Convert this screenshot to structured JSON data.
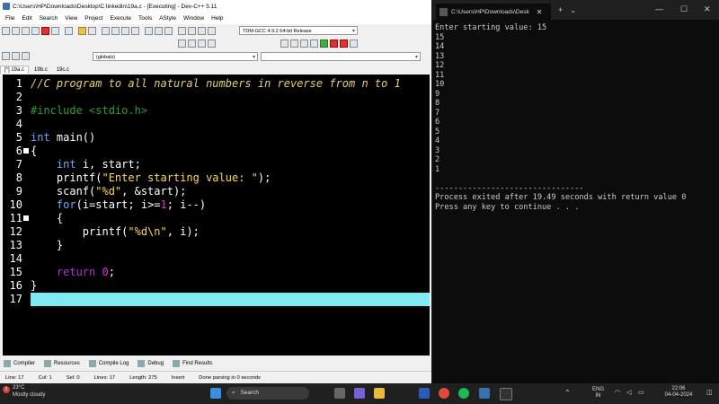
{
  "ide": {
    "title": "C:\\Users\\HP\\Downloads\\Desktop\\C linkedin\\19a.c - [Executing] - Dev-C++ 5.11",
    "menu": [
      "File",
      "Edit",
      "Search",
      "View",
      "Project",
      "Execute",
      "Tools",
      "AStyle",
      "Window",
      "Help"
    ],
    "compiler_select": "TDM-GCC 4.9.2 64-bit Release",
    "scope_select": "(globals)",
    "tabs": [
      "[*] 19a.c",
      "19b.c",
      "19c.c"
    ],
    "code_lines": [
      {
        "n": "1",
        "fold": false,
        "hl": false,
        "tokens": [
          {
            "t": "//C program to all natural numbers in reverse from n to 1",
            "c": "comment"
          }
        ]
      },
      {
        "n": "2",
        "fold": false,
        "hl": false,
        "tokens": []
      },
      {
        "n": "3",
        "fold": false,
        "hl": false,
        "tokens": [
          {
            "t": "#include <stdio.h>",
            "c": "pre"
          }
        ]
      },
      {
        "n": "4",
        "fold": false,
        "hl": false,
        "tokens": []
      },
      {
        "n": "5",
        "fold": false,
        "hl": false,
        "tokens": [
          {
            "t": "int",
            "c": "kw"
          },
          {
            "t": " main()",
            "c": "plain"
          }
        ]
      },
      {
        "n": "6",
        "fold": true,
        "hl": false,
        "tokens": [
          {
            "t": "{",
            "c": "plain"
          }
        ]
      },
      {
        "n": "7",
        "fold": false,
        "hl": false,
        "tokens": [
          {
            "t": "    ",
            "c": "plain"
          },
          {
            "t": "int",
            "c": "kw"
          },
          {
            "t": " i, start;",
            "c": "plain"
          }
        ]
      },
      {
        "n": "8",
        "fold": false,
        "hl": false,
        "tokens": [
          {
            "t": "    printf(",
            "c": "plain"
          },
          {
            "t": "\"Enter starting value: \"",
            "c": "str"
          },
          {
            "t": ");",
            "c": "plain"
          }
        ]
      },
      {
        "n": "9",
        "fold": false,
        "hl": false,
        "tokens": [
          {
            "t": "    scanf(",
            "c": "plain"
          },
          {
            "t": "\"%d\"",
            "c": "str"
          },
          {
            "t": ", &start);",
            "c": "plain"
          }
        ]
      },
      {
        "n": "10",
        "fold": false,
        "hl": false,
        "tokens": [
          {
            "t": "    ",
            "c": "plain"
          },
          {
            "t": "for",
            "c": "kw"
          },
          {
            "t": "(i=start; i>=",
            "c": "plain"
          },
          {
            "t": "1",
            "c": "num"
          },
          {
            "t": "; i--)",
            "c": "plain"
          }
        ]
      },
      {
        "n": "11",
        "fold": true,
        "hl": false,
        "tokens": [
          {
            "t": "    {",
            "c": "plain"
          }
        ]
      },
      {
        "n": "12",
        "fold": false,
        "hl": false,
        "tokens": [
          {
            "t": "        printf(",
            "c": "plain"
          },
          {
            "t": "\"%d\\n\"",
            "c": "str"
          },
          {
            "t": ", i);",
            "c": "plain"
          }
        ]
      },
      {
        "n": "13",
        "fold": false,
        "hl": false,
        "tokens": [
          {
            "t": "    }",
            "c": "plain"
          }
        ]
      },
      {
        "n": "14",
        "fold": false,
        "hl": false,
        "tokens": []
      },
      {
        "n": "15",
        "fold": false,
        "hl": false,
        "tokens": [
          {
            "t": "    ",
            "c": "plain"
          },
          {
            "t": "return",
            "c": "kw2"
          },
          {
            "t": " ",
            "c": "plain"
          },
          {
            "t": "0",
            "c": "num"
          },
          {
            "t": ";",
            "c": "plain"
          }
        ]
      },
      {
        "n": "16",
        "fold": false,
        "hl": false,
        "tokens": [
          {
            "t": "}",
            "c": "plain"
          }
        ]
      },
      {
        "n": "17",
        "fold": false,
        "hl": true,
        "tokens": []
      }
    ],
    "bottom_tabs": [
      "Compiler",
      "Resources",
      "Compile Log",
      "Debug",
      "Find Results"
    ],
    "status": {
      "line": "Line:   17",
      "col": "Col:   1",
      "sel": "Sel:   0",
      "lines": "Lines:   17",
      "length": "Length:   275",
      "mode": "Insert",
      "message": "Done parsing in 0 seconds"
    }
  },
  "terminal": {
    "tab_title": "C:\\Users\\HP\\Downloads\\Desk",
    "output": "Enter starting value: 15\n15\n14\n13\n12\n11\n10\n9\n8\n7\n6\n5\n4\n3\n2\n1\n\n--------------------------------\nProcess exited after 19.49 seconds with return value 0\nPress any key to continue . . ."
  },
  "taskbar": {
    "temp": "23°C",
    "weather": "Mostly cloudy",
    "badge": "1",
    "search_label": "Search",
    "lang_top": "ENG",
    "lang_bottom": "IN",
    "time": "22:06",
    "date": "04-04-2024"
  }
}
